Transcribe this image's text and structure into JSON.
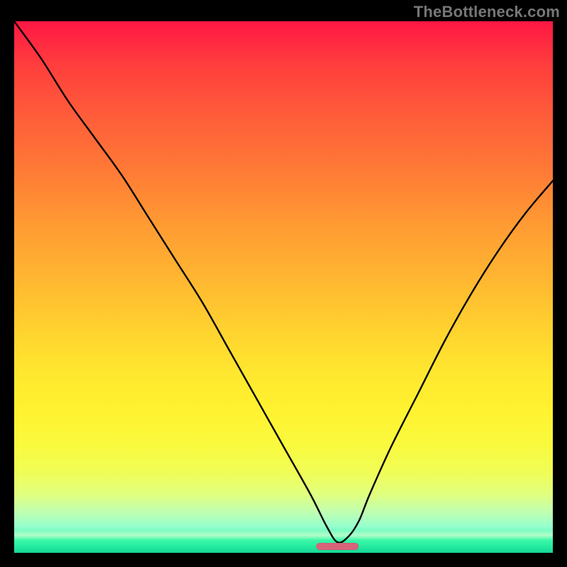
{
  "watermark": "TheBottleneck.com",
  "colors": {
    "top": "#ff1744",
    "mid": "#ffd22f",
    "bottom": "#18d696",
    "curve": "#000000",
    "marker": "#d8647a"
  },
  "chart_data": {
    "type": "line",
    "title": "",
    "xlabel": "",
    "ylabel": "",
    "xlim": [
      0,
      100
    ],
    "ylim": [
      0,
      100
    ],
    "grid": false,
    "legend": false,
    "series": [
      {
        "name": "bottleneck-curve",
        "x": [
          0,
          5,
          10,
          15,
          20,
          25,
          30,
          35,
          40,
          45,
          50,
          55,
          58,
          60,
          62,
          64,
          66,
          70,
          75,
          80,
          85,
          90,
          95,
          100
        ],
        "y": [
          100,
          93,
          85,
          78,
          71,
          63,
          55,
          47,
          38,
          29,
          20,
          11,
          5,
          2,
          3,
          6,
          11,
          20,
          30,
          40,
          49,
          57,
          64,
          70
        ]
      }
    ],
    "minimum": {
      "x_start": 56,
      "x_end": 64,
      "y": 0
    }
  }
}
